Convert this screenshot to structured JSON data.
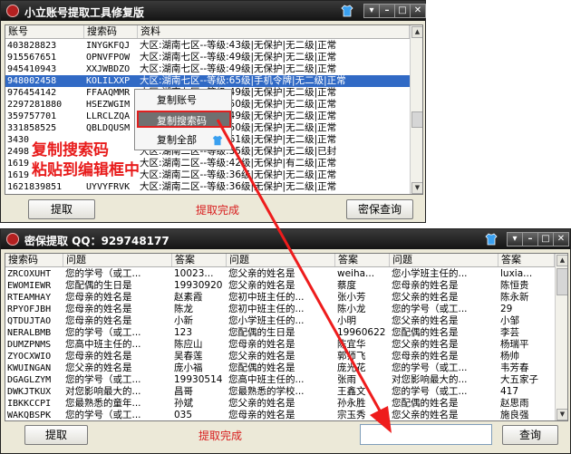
{
  "colors": {
    "title_bg": "#1c1c1c",
    "selection": "#316ac5",
    "accent_red": "#d81e1e",
    "window_bg": "#ece9d8"
  },
  "window1": {
    "title": "小立账号提取工具修复版",
    "columns": [
      "账号",
      "搜索码",
      "资料"
    ],
    "rows": [
      {
        "account": "403828823",
        "code": "INYGKFQJ",
        "info": "大区:湖南七区--等级:43级|无保护|无二级|正常"
      },
      {
        "account": "915567651",
        "code": "OPNVFPOW",
        "info": "大区:湖南七区--等级:49级|无保护|无二级|正常"
      },
      {
        "account": "945410943",
        "code": "XXJWBDZO",
        "info": "大区:湖南七区--等级:49级|无保护|无二级|正常"
      },
      {
        "account": "948002458",
        "code": "KOLILXXP",
        "info": "大区:湖南七区--等级:65级|手机令牌|无二级|正常"
      },
      {
        "account": "976454142",
        "code": "FFAAQMMR",
        "info": "大区:湖南七区--等级:49级|无保护|无二级|正常"
      },
      {
        "account": "2297281880",
        "code": "HSEZWGIM",
        "info": "大区:湖南七区--等级:50级|无保护|无二级|正常"
      },
      {
        "account": "359757701",
        "code": "LLRCLZQA",
        "info": "大区:湖南七区--等级:49级|无保护|无二级|正常"
      },
      {
        "account": "331858525",
        "code": "QBLDQUSM",
        "info": "大区:湖南七区--等级:50级|无保护|无二级|正常"
      },
      {
        "account": "3430",
        "code": "",
        "info": "大区:湖南七区--等级:61级|无保护|无二级|正常"
      },
      {
        "account": "2498",
        "code": "",
        "info": "大区:湖南二区--等级:35级|无保护|无二级|已封"
      },
      {
        "account": "1619",
        "code": "",
        "info": "大区:湖南二区--等级:42级|无保护|有二级|正常"
      },
      {
        "account": "1619",
        "code": "",
        "info": "大区:湖南二区--等级:36级|无保护|无二级|正常"
      },
      {
        "account": "1621839851",
        "code": "UYVYFRVK",
        "info": "大区:湖南二区--等级:36级|无保护|无二级|正常"
      }
    ],
    "context_menu": [
      "复制账号",
      "复制搜索码",
      "复制全部"
    ],
    "annotation_line1": "复制搜索码",
    "annotation_line2": "粘贴到编辑框中",
    "extract_button": "提取",
    "status_text": "提取完成",
    "query_button": "密保查询"
  },
  "window2": {
    "title": "密保提取 QQ：929748177",
    "columns": [
      "搜索码",
      "问题",
      "答案",
      "问题",
      "答案",
      "问题",
      "答案"
    ],
    "rows": [
      [
        "ZRCOXUHT",
        "您的学号（或工...",
        "10023...",
        "您父亲的姓名是",
        "weiha...",
        "您小学班主任的...",
        "luxia..."
      ],
      [
        "EWOMIEWR",
        "您配偶的生日是",
        "19930920",
        "您父亲的姓名是",
        "蔡度",
        "您母亲的姓名是",
        "陈恒贵"
      ],
      [
        "RTEAMHAY",
        "您母亲的姓名是",
        "赵素霞",
        "您初中班主任的...",
        "张小芳",
        "您父亲的姓名是",
        "陈永新"
      ],
      [
        "RPYOFJBH",
        "您母亲的姓名是",
        "陈龙",
        "您初中班主任的...",
        "陈小龙",
        "您的学号（或工...",
        "29"
      ],
      [
        "QTDUJTAO",
        "您母亲的姓名是",
        "小新",
        "您小学班主任的...",
        "小明",
        "您父亲的姓名是",
        "小邹"
      ],
      [
        "NERALBMB",
        "您的学号（或工...",
        "123",
        "您配偶的生日是",
        "19960622",
        "您配偶的姓名是",
        "李芸"
      ],
      [
        "DUMZPNMS",
        "您高中班主任的...",
        "陈应山",
        "您母亲的姓名是",
        "陈宜华",
        "您父亲的姓名是",
        "杨瑞平"
      ],
      [
        "ZYOCXWIO",
        "您母亲的姓名是",
        "吴春莲",
        "您父亲的姓名是",
        "郭师飞",
        "您母亲的姓名是",
        "杨帅"
      ],
      [
        "KWUINGAN",
        "您父亲的姓名是",
        "庞小福",
        "您配偶的姓名是",
        "庞光花",
        "您的学号（或工...",
        "韦芳春"
      ],
      [
        "DGAGLZYM",
        "您的学号（或工...",
        "19930514",
        "您高中班主任的...",
        "张雨",
        "对您影响最大的...",
        "大五家子"
      ],
      [
        "DWKJTKUX",
        "对您影响最大的...",
        "昌哥",
        "您最熟悉的学校...",
        "王鑫文",
        "您的学号（或工...",
        "417"
      ],
      [
        "IBKKCCPI",
        "您最熟悉的童年...",
        "孙斌",
        "您父亲的姓名是",
        "孙永胜",
        "您配偶的姓名是",
        "赵思雨"
      ],
      [
        "WAKQBSPK",
        "您的学号（或工...",
        "035",
        "您母亲的姓名是",
        "宗玉秀",
        "您父亲的姓名是",
        "施良强"
      ]
    ],
    "extract_button": "提取",
    "status_text": "提取完成",
    "query_input_value": "",
    "query_button": "查询"
  }
}
